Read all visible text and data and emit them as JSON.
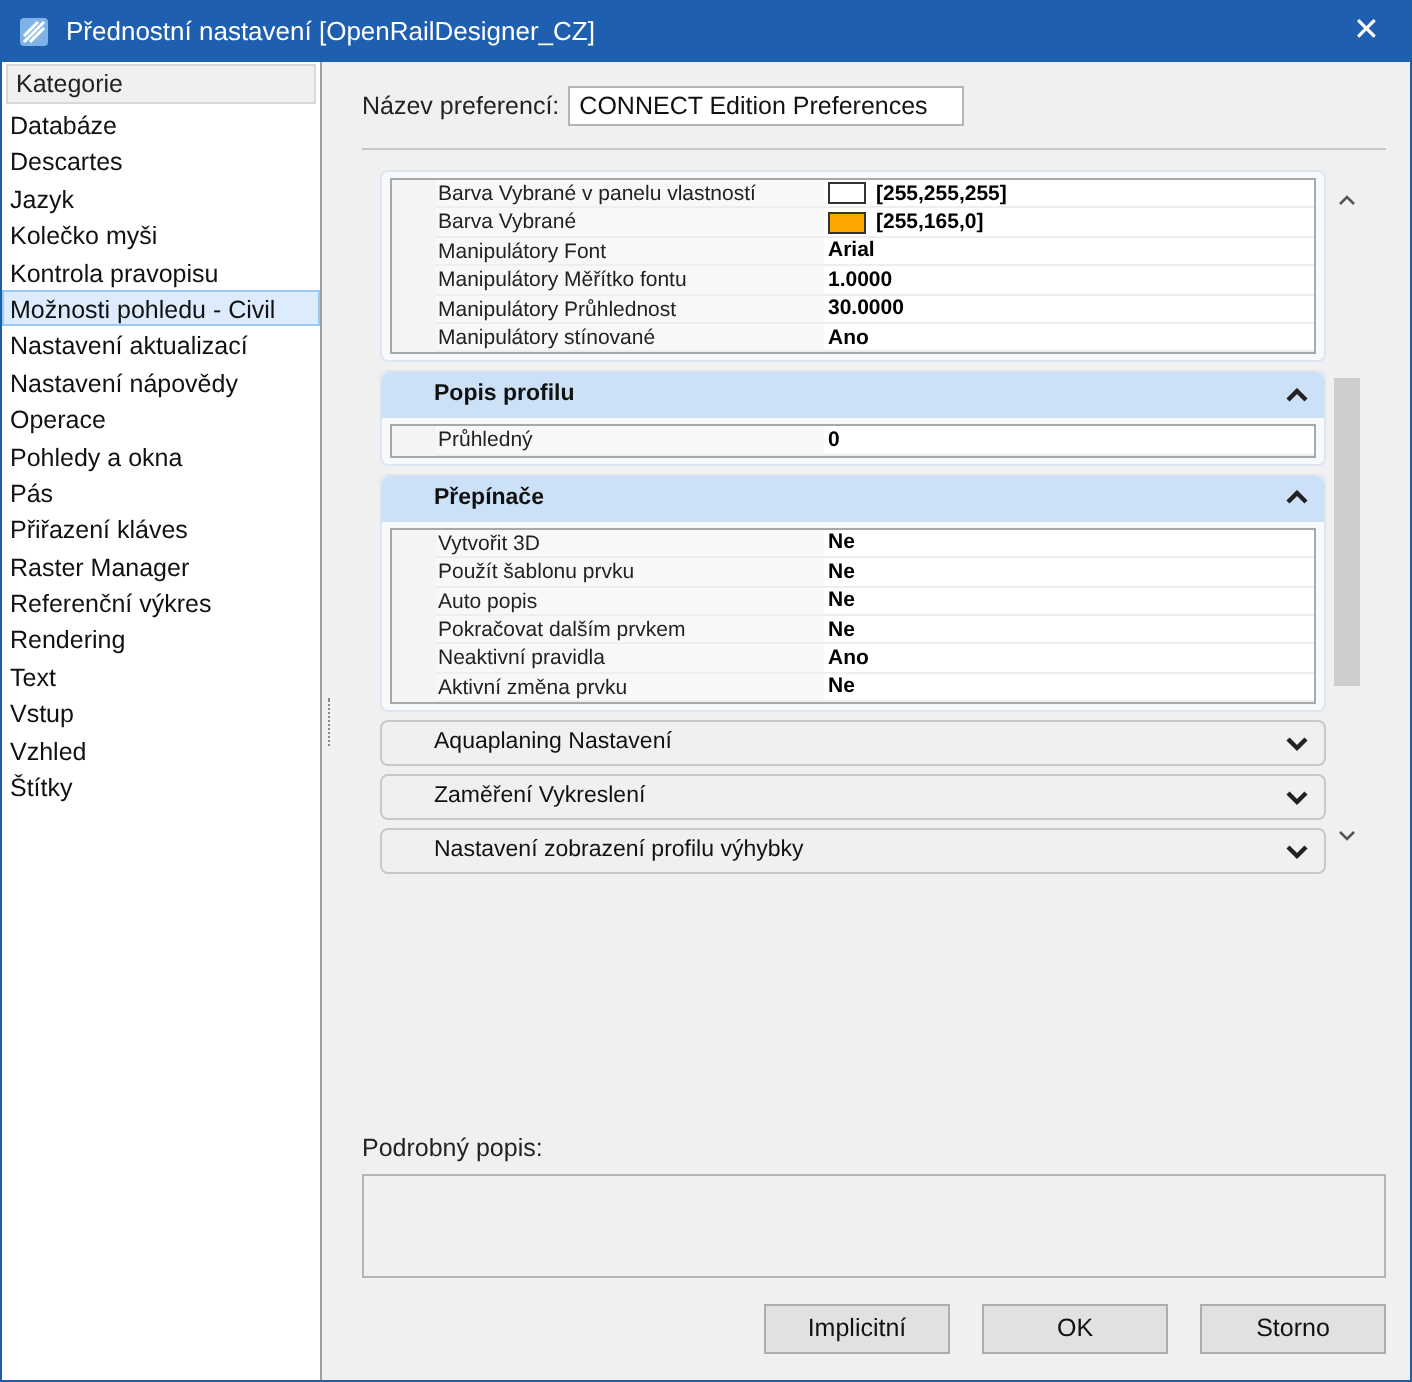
{
  "window": {
    "title": "Přednostní nastavení [OpenRailDesigner_CZ]",
    "close": "✕"
  },
  "sidebar": {
    "header": "Kategorie",
    "items": [
      {
        "label": "Databáze",
        "selected": false
      },
      {
        "label": "Descartes",
        "selected": false
      },
      {
        "label": "Jazyk",
        "selected": false
      },
      {
        "label": "Kolečko myši",
        "selected": false
      },
      {
        "label": "Kontrola pravopisu",
        "selected": false
      },
      {
        "label": "Možnosti pohledu - Civil",
        "selected": true
      },
      {
        "label": "Nastavení aktualizací",
        "selected": false
      },
      {
        "label": "Nastavení nápovědy",
        "selected": false
      },
      {
        "label": "Operace",
        "selected": false
      },
      {
        "label": "Pohledy a okna",
        "selected": false
      },
      {
        "label": "Pás",
        "selected": false
      },
      {
        "label": "Přiřazení kláves",
        "selected": false
      },
      {
        "label": "Raster Manager",
        "selected": false
      },
      {
        "label": "Referenční výkres",
        "selected": false
      },
      {
        "label": "Rendering",
        "selected": false
      },
      {
        "label": "Text",
        "selected": false
      },
      {
        "label": "Vstup",
        "selected": false
      },
      {
        "label": "Vzhled",
        "selected": false
      },
      {
        "label": "Štítky",
        "selected": false
      }
    ]
  },
  "preference_name": {
    "label": "Název preferencí:",
    "value": "CONNECT Edition Preferences"
  },
  "sections": [
    {
      "rows": [
        {
          "name": "Barva Vybrané v panelu vlastností",
          "value": "[255,255,255]",
          "color": "#ffffff"
        },
        {
          "name": "Barva Vybrané",
          "value": "[255,165,0]",
          "color": "#ffa500"
        },
        {
          "name": "Manipulátory Font",
          "value": "Arial"
        },
        {
          "name": "Manipulátory Měřítko fontu",
          "value": "1.0000"
        },
        {
          "name": "Manipulátory Průhlednost",
          "value": "30.0000"
        },
        {
          "name": "Manipulátory stínované",
          "value": "Ano"
        }
      ]
    },
    {
      "title": "Popis profilu",
      "expanded": true,
      "rows": [
        {
          "name": "Průhledný",
          "value": "0"
        }
      ]
    },
    {
      "title": "Přepínače",
      "expanded": true,
      "rows": [
        {
          "name": "Vytvořit 3D",
          "value": "Ne"
        },
        {
          "name": "Použít šablonu prvku",
          "value": "Ne"
        },
        {
          "name": "Auto popis",
          "value": "Ne"
        },
        {
          "name": "Pokračovat dalším prvkem",
          "value": "Ne"
        },
        {
          "name": "Neaktivní pravidla",
          "value": "Ano"
        },
        {
          "name": "Aktivní změna prvku",
          "value": "Ne"
        }
      ]
    },
    {
      "title": "Aquaplaning Nastavení",
      "expanded": false
    },
    {
      "title": "Zaměření Vykreslení",
      "expanded": false
    },
    {
      "title": "Nastavení zobrazení profilu výhybky",
      "expanded": false
    }
  ],
  "description": {
    "label": "Podrobný popis:"
  },
  "buttons": [
    "Implicitní",
    "OK",
    "Storno"
  ]
}
